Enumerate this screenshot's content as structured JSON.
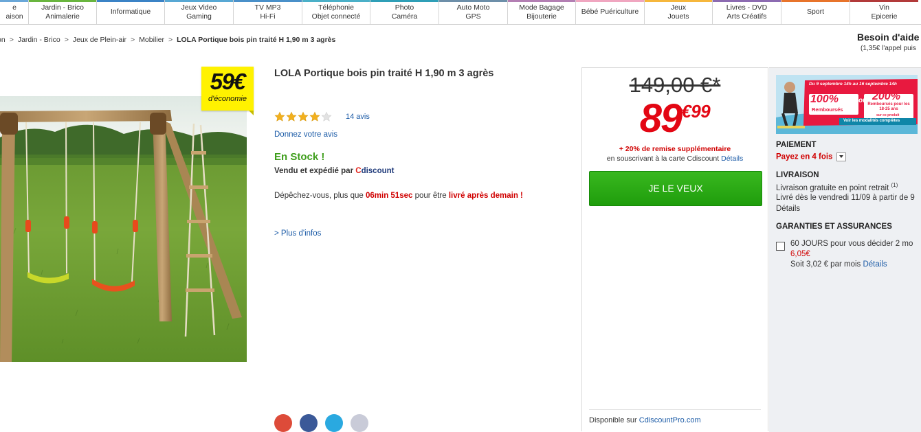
{
  "nav": {
    "items": [
      {
        "line1": "e",
        "line2": "aison",
        "color": "#6aa7d8"
      },
      {
        "line1": "Jardin - Brico",
        "line2": "Animalerie",
        "color": "#69b53f"
      },
      {
        "line1": "Informatique",
        "line2": "",
        "color": "#3b83c6"
      },
      {
        "line1": "Jeux Video",
        "line2": "Gaming",
        "color": "#58a8d4"
      },
      {
        "line1": "TV MP3",
        "line2": "Hi-Fi",
        "color": "#4a90c9"
      },
      {
        "line1": "Téléphonie",
        "line2": "Objet connecté",
        "color": "#4bb0c8"
      },
      {
        "line1": "Photo",
        "line2": "Caméra",
        "color": "#2f9fb7"
      },
      {
        "line1": "Auto Moto",
        "line2": "GPS",
        "color": "#6d8fa9"
      },
      {
        "line1": "Mode Bagage",
        "line2": "Bijouterie",
        "color": "#b37fb3"
      },
      {
        "line1": "Bébé Puériculture",
        "line2": "",
        "color": "#f0a6c0"
      },
      {
        "line1": "Jeux",
        "line2": "Jouets",
        "color": "#f6b73c"
      },
      {
        "line1": "Livres - DVD",
        "line2": "Arts Créatifs",
        "color": "#8c6bb1"
      },
      {
        "line1": "Sport",
        "line2": "",
        "color": "#e8742b"
      },
      {
        "line1": "Vin",
        "line2": "Epicerie",
        "color": "#b23a3a"
      }
    ]
  },
  "breadcrumb": {
    "items": [
      "on",
      "Jardin - Brico",
      "Jeux de Plein-air",
      "Mobilier"
    ],
    "current": "LOLA Portique bois pin traité H 1,90 m 3 agrès"
  },
  "help": {
    "title": "Besoin d'aide",
    "subtitle": "(1,35€ l'appel puis"
  },
  "badge": {
    "amount": "59€",
    "label": "d'économie"
  },
  "product": {
    "title": "LOLA Portique bois pin traité H 1,90 m 3 agrès",
    "rating": 4,
    "rating_max": 5,
    "reviews": "14 avis",
    "give_review": "Donnez votre avis",
    "stock": "En Stock !",
    "seller_prefix": "Vendu et expédié par",
    "seller_c": "C",
    "seller_rest": "discount",
    "hurry_1": "Dépêchez-vous, plus que",
    "hurry_time": "06min 51sec",
    "hurry_2": "pour être",
    "hurry_3": "livré après demain !",
    "more_info": "> Plus d'infos"
  },
  "price": {
    "old": "149,00 €*",
    "new_int": "89",
    "new_dec": "€99",
    "discount": "+ 20% de remise supplémentaire",
    "card_text": "en souscrivant à la carte Cdiscount",
    "card_link": "Détails",
    "buy_label": "JE LE VEUX",
    "footer_prefix": "Disponible sur",
    "footer_link": "CdiscountPro.com"
  },
  "promo": {
    "banner_dates": "Du 9 septembre 14h au 16 septembre 14h",
    "pct1": "100%",
    "pct1_label": "Remboursés",
    "or": "ou",
    "pct2": "200%",
    "pct2_label": "Remboursés pour les 18-25 ans",
    "pct2_note": "sur ce produit",
    "cta": "Voir les modalités complètes"
  },
  "right": {
    "payment_title": "PAIEMENT",
    "payment_value": "Payez en 4 fois",
    "delivery_title": "LIVRAISON",
    "delivery_line1": "Livraison gratuite en point retrait",
    "delivery_sup": "(1)",
    "delivery_line2": "Livré dès le vendredi 11/09 à partir de 9",
    "delivery_link": "Détails",
    "guarantee_title": "GARANTIES ET ASSURANCES",
    "guarantee_line1": "60 JOURS pour vous décider 2 mo",
    "guarantee_price": "6,05€",
    "guarantee_line3": "Soit 3,02 € par mois",
    "guarantee_link": "Détails"
  },
  "colors": {
    "price_red": "#e30613",
    "stock_green": "#3f9e1c",
    "buy_green": "#2aa814",
    "link_blue": "#1a5aa6",
    "badge_yellow": "#fff200"
  }
}
